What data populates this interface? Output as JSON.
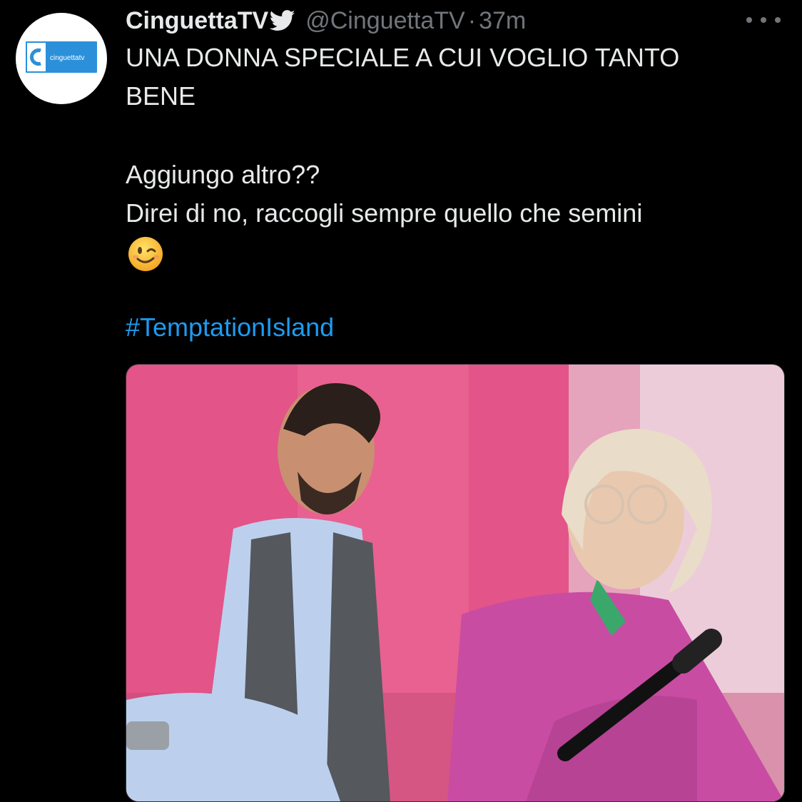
{
  "tweet": {
    "avatar_logo_text": "cinguettatv",
    "author_name": "CinguettaTV",
    "handle": "@CinguettaTV",
    "separator": "·",
    "time": "37m",
    "lines": [
      "UNA DONNA SPECIALE A CUI VOGLIO TANTO",
      "BENE",
      "Aggiungo altro??",
      "Direi di no, raccogli sempre quello che semini"
    ],
    "emoji": "winking-face",
    "hashtag": "#TemptationIsland"
  },
  "colors": {
    "background": "#000000",
    "text": "#e7e9ea",
    "secondary": "#71767b",
    "link": "#1d9bf0",
    "logo_blue": "#2b90d9",
    "backdrop_pink": "#e85a8c",
    "sweater_magenta": "#c94ca3",
    "shirt_blue": "#bcd0ee"
  },
  "icons": [
    "bird-icon",
    "more-options-icon",
    "winking-face-emoji"
  ]
}
